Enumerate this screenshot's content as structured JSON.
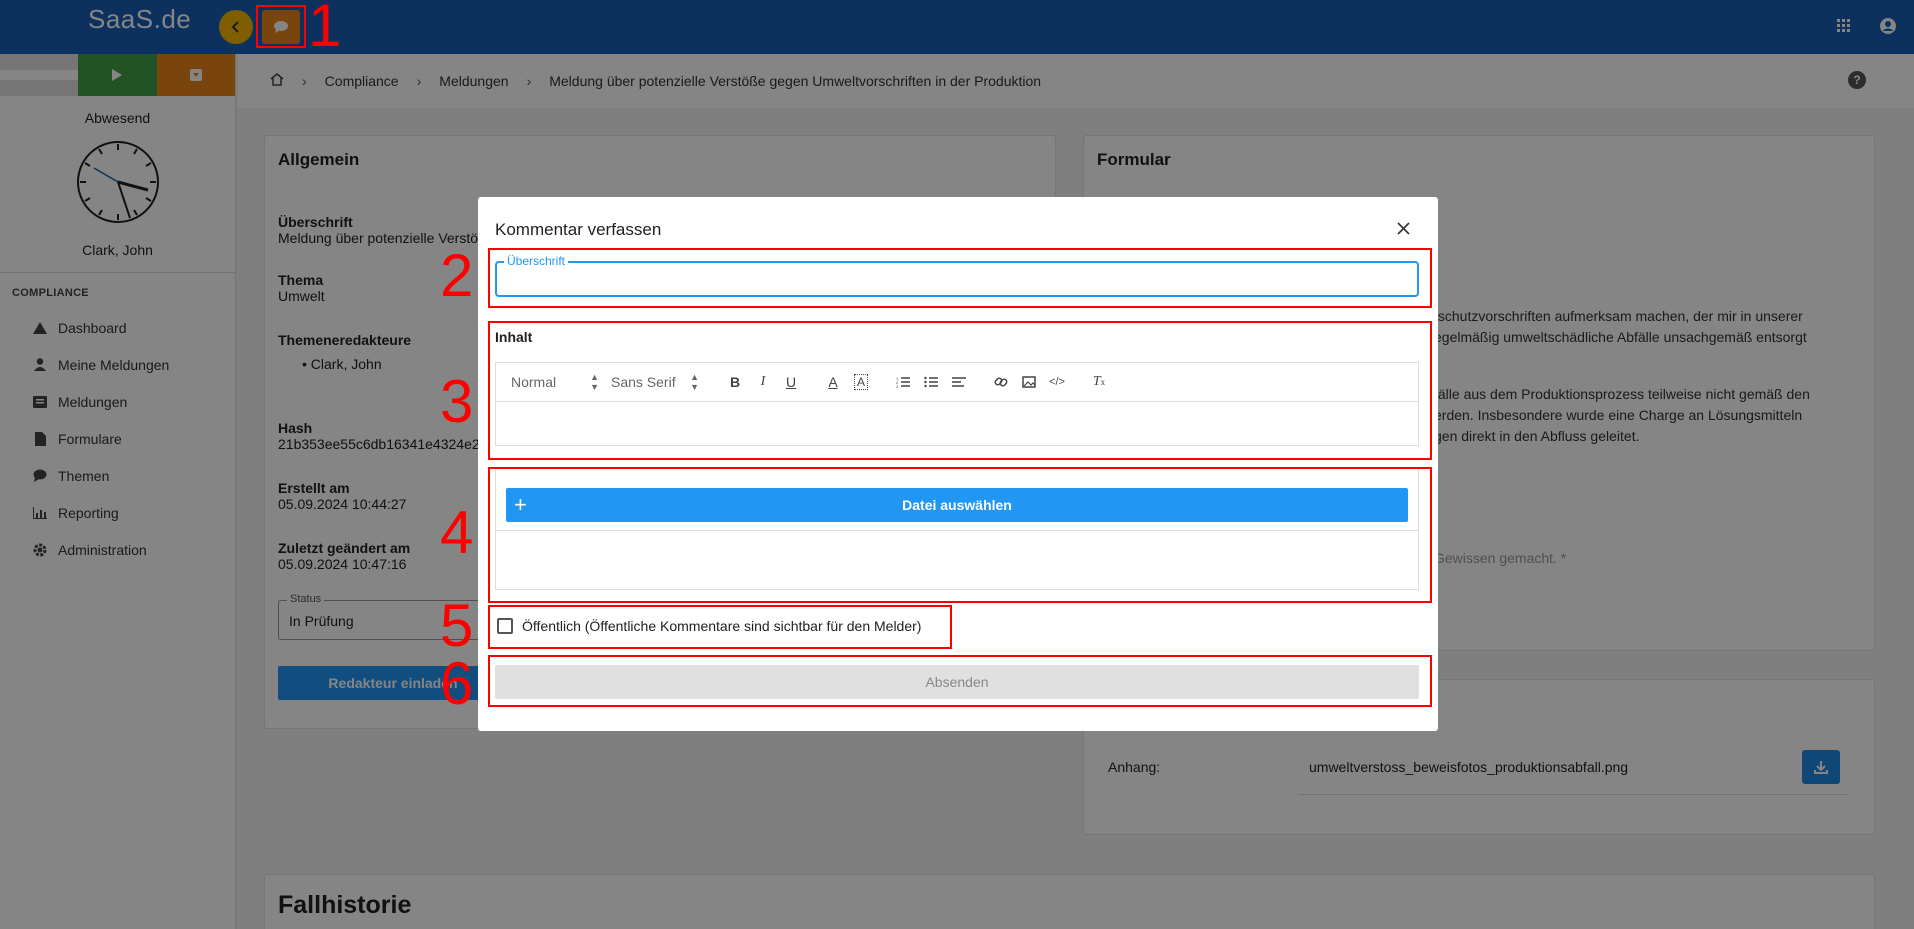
{
  "app": {
    "logo": "SaaS.de"
  },
  "breadcrumb": [
    "Compliance",
    "Meldungen",
    "Meldung über potenzielle Verstöße gegen Umweltvorschriften in der Produktion"
  ],
  "sidebar": {
    "status": "Abwesend",
    "user": "Clark, John",
    "section": "COMPLIANCE",
    "items": [
      {
        "label": "Dashboard",
        "icon": "dashboard-icon"
      },
      {
        "label": "Meine Meldungen",
        "icon": "user-icon"
      },
      {
        "label": "Meldungen",
        "icon": "inbox-icon"
      },
      {
        "label": "Formulare",
        "icon": "file-icon"
      },
      {
        "label": "Themen",
        "icon": "comment-icon"
      },
      {
        "label": "Reporting",
        "icon": "chart-icon"
      },
      {
        "label": "Administration",
        "icon": "gear-icon"
      }
    ]
  },
  "general": {
    "title": "Allgemein",
    "heading_label": "Überschrift",
    "heading_value": "Meldung über potenzielle Verstö",
    "topic_label": "Thema",
    "topic_value": "Umwelt",
    "editors_label": "Themeneredakteure",
    "editor": "Clark, John",
    "hash_label": "Hash",
    "hash_value": "21b353ee55c6db16341e4324e2",
    "created_label": "Erstellt am",
    "created_value": "05.09.2024 10:44:27",
    "modified_label": "Zuletzt geändert am",
    "modified_value": "05.09.2024 10:47:16",
    "status_label": "Status",
    "status_value": "In Prüfung",
    "invite_button": "Redakteur einladen"
  },
  "form": {
    "title": "Formular",
    "text1_l1": "tschutzvorschriften aufmerksam machen, der mir in unserer",
    "text1_l2": "egelmäßig umweltschädliche Abfälle unsachgemäß entsorgt",
    "text2_l1": "fälle aus dem Produktionsprozess teilweise nicht gemäß den",
    "text2_l2": "erden. Insbesondere wurde eine Charge an Lösungsmitteln",
    "text2_l3": "gen direkt in den Abfluss geleitet.",
    "text3": "Gewissen gemacht. *",
    "attachment_label": "Anhang:",
    "attachment_file": "umweltverstoss_beweisfotos_produktionsabfall.png"
  },
  "history": {
    "title": "Fallhistorie"
  },
  "modal": {
    "title": "Kommentar verfassen",
    "heading_label": "Überschrift",
    "heading_value": "",
    "content_label": "Inhalt",
    "toolbar": {
      "size": "Normal",
      "font": "Sans Serif"
    },
    "file_button": "Datei auswählen",
    "public_label": "Öffentlich (Öffentliche Kommentare sind sichtbar für den Melder)",
    "submit_button": "Absenden"
  },
  "annotations": [
    "1",
    "2",
    "3",
    "4",
    "5",
    "6"
  ],
  "colors": {
    "topbar": "#1a5fb4",
    "accent": "#2196f3",
    "annotation": "#ff0000"
  }
}
